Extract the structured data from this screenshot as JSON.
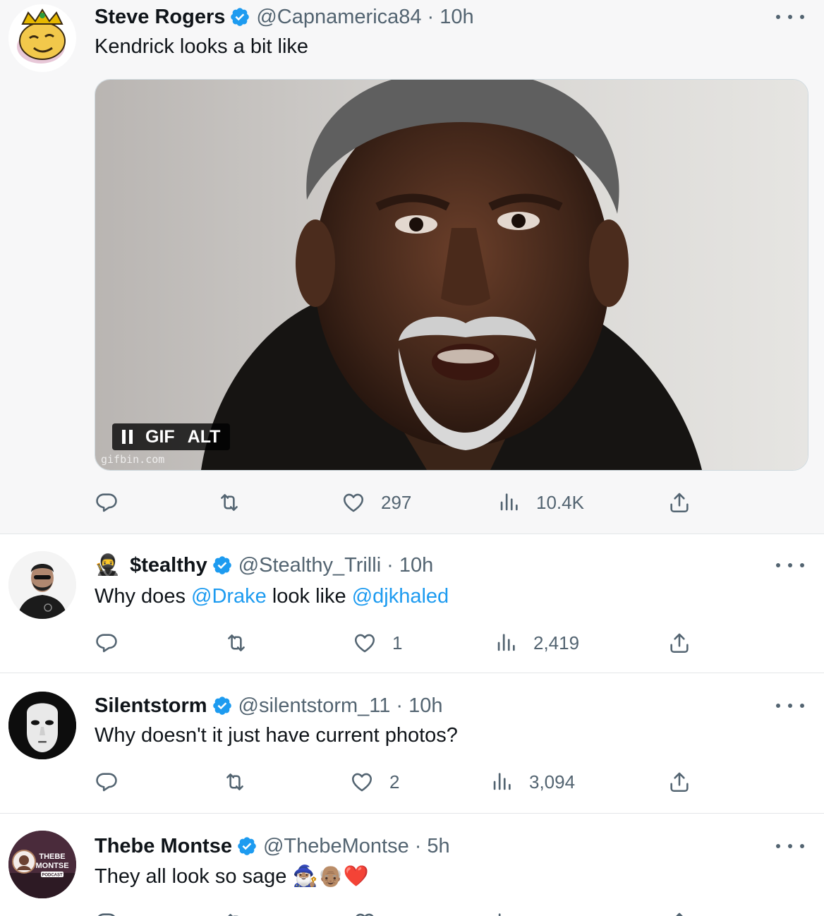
{
  "tweets": [
    {
      "name": "Steve Rogers",
      "handle": "@Capnamerica84",
      "time": "10h",
      "text": "Kendrick looks a bit like",
      "media": {
        "gif_label": "GIF",
        "alt_label": "ALT",
        "watermark": "gifbin.com"
      },
      "likes": "297",
      "views": "10.4K"
    },
    {
      "name_emoji": "🥷",
      "name": "$tealthy",
      "handle": "@Stealthy_Trilli",
      "time": "10h",
      "text_parts": [
        "Why does ",
        "@Drake",
        " look like ",
        "@djkhaled"
      ],
      "likes": "1",
      "views": "2,419"
    },
    {
      "name": "Silentstorm",
      "handle": "@silentstorm_11",
      "time": "10h",
      "text": "Why doesn't it just have current photos?",
      "likes": "2",
      "views": "3,094"
    },
    {
      "name": "Thebe Montse",
      "handle": "@ThebeMontse",
      "time": "5h",
      "text": "They all look so sage 🧙🏽‍♂️👴🏽❤️",
      "avatar_text": [
        "THEBE",
        "MONTSE",
        "PODCAST"
      ]
    }
  ],
  "colors": {
    "accent": "#1d9bf0",
    "muted": "#536471",
    "text": "#0f1419"
  },
  "icons": [
    "verified-badge-icon",
    "reply-icon",
    "retweet-icon",
    "like-icon",
    "views-icon",
    "share-icon",
    "more-icon",
    "pause-icon"
  ]
}
